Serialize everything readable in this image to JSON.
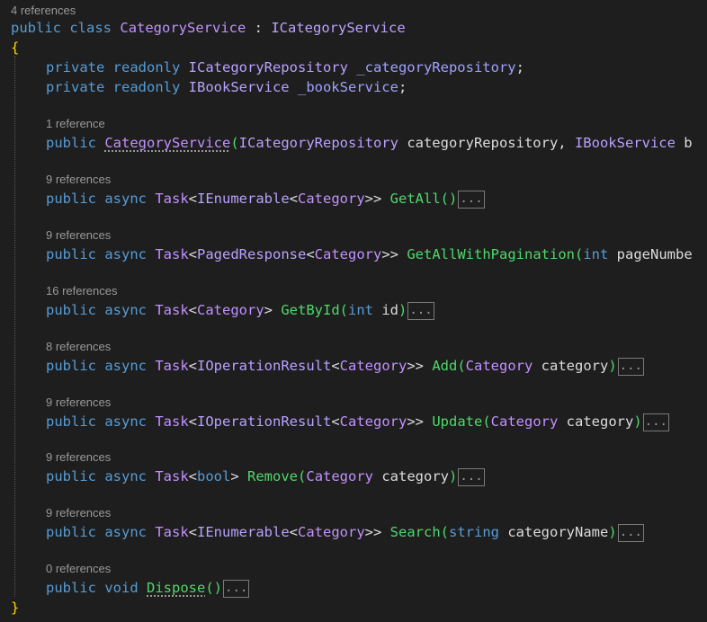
{
  "class_header": {
    "refs": "4 references",
    "kw_public": "public",
    "kw_class": "class",
    "name": "CategoryService",
    "colon": " : ",
    "iface": "ICategoryService",
    "open_brace": "{",
    "close_brace": "}"
  },
  "fields": [
    {
      "mods": "private readonly",
      "type": "ICategoryRepository",
      "name": "_categoryRepository",
      "semi": ";"
    },
    {
      "mods": "private readonly",
      "type": "IBookService",
      "name": "_bookService",
      "semi": ";"
    }
  ],
  "ctor": {
    "refs": "1 reference",
    "kw": "public",
    "name": "CategoryService",
    "open": "(",
    "p1_type": "ICategoryRepository",
    "p1_name": " categoryRepository, ",
    "p2_type": "IBookService",
    "p2_name": " b"
  },
  "methods": [
    {
      "refs": "9 references",
      "kw": "public async",
      "task": "Task",
      "lt": "<",
      "inner": "IEnumerable",
      "lt2": "<",
      "gen": "Category",
      "gt": ">>",
      "name": "GetAll",
      "params": "",
      "collapse": "..."
    },
    {
      "refs": "9 references",
      "kw": "public async",
      "task": "Task",
      "lt": "<",
      "inner": "PagedResponse",
      "lt2": "<",
      "gen": "Category",
      "gt": ">>",
      "name": "GetAllWithPagination",
      "params_kw": "int",
      "params": " pageNumbe",
      "collapse": ""
    },
    {
      "refs": "16 references",
      "kw": "public async",
      "task": "Task",
      "lt": "<",
      "inner": "",
      "lt2": "",
      "gen": "Category",
      "gt": ">",
      "name": "GetById",
      "params_kw": "int",
      "params": " id",
      "collapse": "..."
    },
    {
      "refs": "8 references",
      "kw": "public async",
      "task": "Task",
      "lt": "<",
      "inner": "IOperationResult",
      "lt2": "<",
      "gen": "Category",
      "gt": ">>",
      "name": "Add",
      "params_type": "Category",
      "params": " category",
      "collapse": "..."
    },
    {
      "refs": "9 references",
      "kw": "public async",
      "task": "Task",
      "lt": "<",
      "inner": "IOperationResult",
      "lt2": "<",
      "gen": "Category",
      "gt": ">>",
      "name": "Update",
      "params_type": "Category",
      "params": " category",
      "collapse": "..."
    },
    {
      "refs": "9 references",
      "kw": "public async",
      "task": "Task",
      "lt": "<",
      "inner": "",
      "lt2": "",
      "gen": "bool",
      "gt": ">",
      "name": "Remove",
      "params_type": "Category",
      "params": " category",
      "collapse": "..."
    },
    {
      "refs": "9 references",
      "kw": "public async",
      "task": "Task",
      "lt": "<",
      "inner": "IEnumerable",
      "lt2": "<",
      "gen": "Category",
      "gt": ">>",
      "name": "Search",
      "params_kw": "string",
      "params": " categoryName",
      "collapse": "..."
    },
    {
      "refs": "0 references",
      "kw": "public",
      "kw2": "void",
      "name": "Dispose",
      "params": "",
      "collapse": "..."
    }
  ]
}
